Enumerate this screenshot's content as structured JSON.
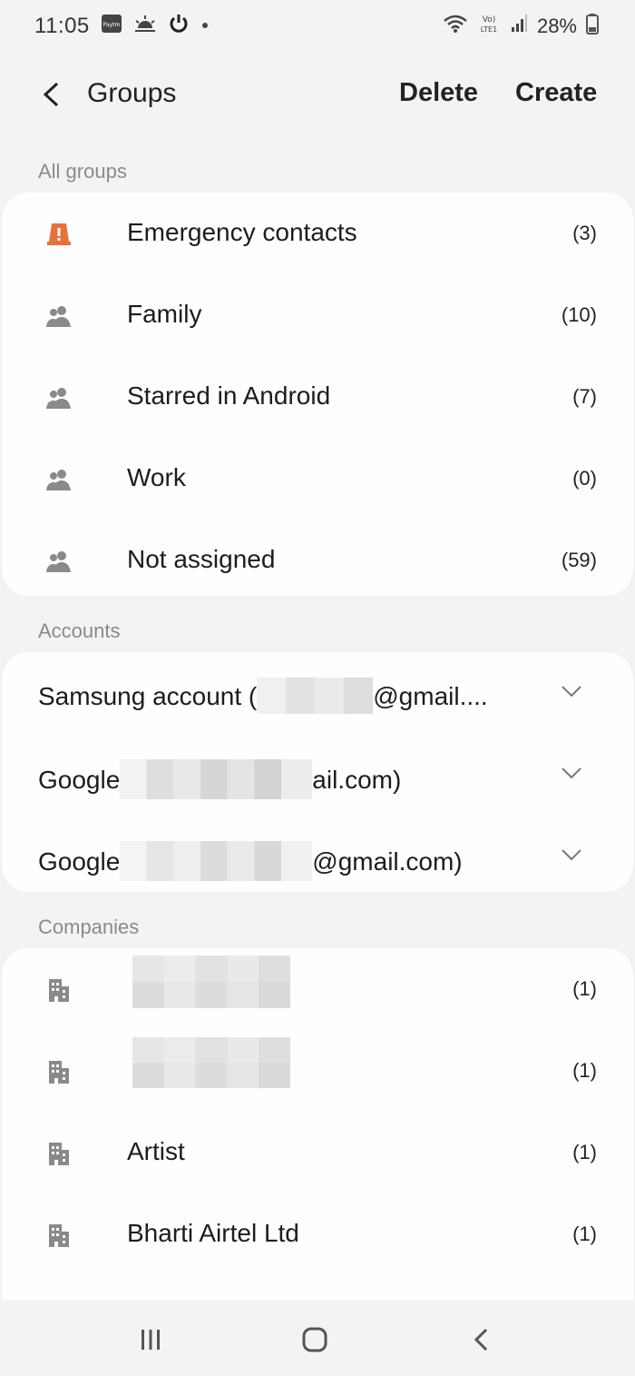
{
  "status_bar": {
    "time": "11:05",
    "battery": "28%",
    "icons": [
      "paytm-icon",
      "sunrise-icon",
      "power-icon",
      "dot-icon",
      "wifi-icon",
      "volte-icon",
      "signal-icon",
      "battery-icon"
    ]
  },
  "app_bar": {
    "title": "Groups",
    "delete_label": "Delete",
    "create_label": "Create"
  },
  "all_groups": {
    "header": "All groups",
    "items": [
      {
        "label": "Emergency contacts",
        "count": "(3)",
        "icon": "emergency-icon"
      },
      {
        "label": "Family",
        "count": "(10)",
        "icon": "group-icon"
      },
      {
        "label": "Starred in Android",
        "count": "(7)",
        "icon": "group-icon"
      },
      {
        "label": "Work",
        "count": "(0)",
        "icon": "group-icon"
      },
      {
        "label": "Not assigned",
        "count": "(59)",
        "icon": "group-icon"
      }
    ]
  },
  "accounts": {
    "header": "Accounts",
    "items": [
      {
        "label_prefix": "Samsung account (",
        "label_suffix": "@gmail...."
      },
      {
        "label_prefix": "Google",
        "label_suffix": "ail.com)"
      },
      {
        "label_prefix": "Google",
        "label_suffix": "@gmail.com)"
      }
    ]
  },
  "companies": {
    "header": "Companies",
    "items": [
      {
        "label": "",
        "count": "(1)"
      },
      {
        "label": "",
        "count": "(1)"
      },
      {
        "label": "Artist",
        "count": "(1)"
      },
      {
        "label": "Bharti Airtel Ltd",
        "count": "(1)"
      }
    ]
  },
  "colors": {
    "emergency": "#e8703a",
    "icon_gray": "#8a8a8a",
    "background": "#f3f3f3",
    "card": "#fefefe"
  }
}
